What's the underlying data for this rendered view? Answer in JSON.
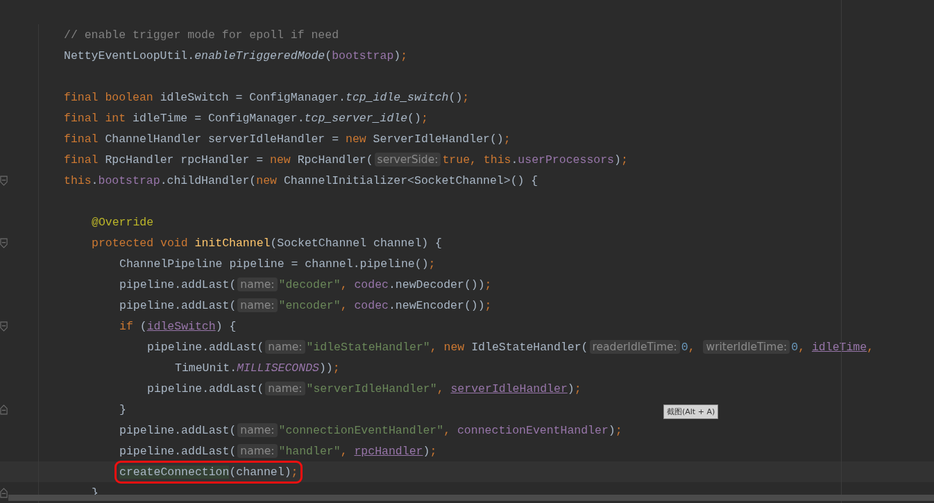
{
  "editor": {
    "lines": [
      {
        "kind": "code",
        "tokens": [
          {
            "kind": "comment",
            "text": "// enable trigger mode for epoll if need"
          }
        ]
      },
      {
        "kind": "code",
        "tokens": [
          {
            "kind": "plain",
            "text": "NettyEventLoopUtil."
          },
          {
            "kind": "static",
            "text": "enableTriggeredMode"
          },
          {
            "kind": "plain",
            "text": "("
          },
          {
            "kind": "field",
            "text": "bootstrap"
          },
          {
            "kind": "plain",
            "text": ")"
          },
          {
            "kind": "punct",
            "text": ";"
          }
        ]
      },
      {
        "kind": "blank"
      },
      {
        "kind": "code",
        "tokens": [
          {
            "kind": "keyword",
            "text": "final boolean"
          },
          {
            "kind": "plain",
            "text": " idleSwitch = ConfigManager."
          },
          {
            "kind": "static",
            "text": "tcp_idle_switch"
          },
          {
            "kind": "plain",
            "text": "()"
          },
          {
            "kind": "punct",
            "text": ";"
          }
        ]
      },
      {
        "kind": "code",
        "tokens": [
          {
            "kind": "keyword",
            "text": "final int"
          },
          {
            "kind": "plain",
            "text": " idleTime = ConfigManager."
          },
          {
            "kind": "static",
            "text": "tcp_server_idle"
          },
          {
            "kind": "plain",
            "text": "()"
          },
          {
            "kind": "punct",
            "text": ";"
          }
        ]
      },
      {
        "kind": "code",
        "tokens": [
          {
            "kind": "keyword",
            "text": "final"
          },
          {
            "kind": "plain",
            "text": " ChannelHandler serverIdleHandler = "
          },
          {
            "kind": "keyword",
            "text": "new"
          },
          {
            "kind": "plain",
            "text": " ServerIdleHandler()"
          },
          {
            "kind": "punct",
            "text": ";"
          }
        ]
      },
      {
        "kind": "code",
        "tokens": [
          {
            "kind": "keyword",
            "text": "final"
          },
          {
            "kind": "plain",
            "text": " RpcHandler rpcHandler = "
          },
          {
            "kind": "keyword",
            "text": "new"
          },
          {
            "kind": "plain",
            "text": " RpcHandler("
          },
          {
            "kind": "hint",
            "text": "serverSide:"
          },
          {
            "kind": "keyword",
            "text": "true"
          },
          {
            "kind": "punct",
            "text": ", "
          },
          {
            "kind": "keyword",
            "text": "this"
          },
          {
            "kind": "plain",
            "text": "."
          },
          {
            "kind": "field",
            "text": "userProcessors"
          },
          {
            "kind": "plain",
            "text": ")"
          },
          {
            "kind": "punct",
            "text": ";"
          }
        ]
      },
      {
        "kind": "code",
        "fold_start": true,
        "tokens": [
          {
            "kind": "keyword",
            "text": "this"
          },
          {
            "kind": "plain",
            "text": "."
          },
          {
            "kind": "field",
            "text": "bootstrap"
          },
          {
            "kind": "plain",
            "text": ".childHandler("
          },
          {
            "kind": "keyword",
            "text": "new"
          },
          {
            "kind": "plain",
            "text": " ChannelInitializer<SocketChannel>() {"
          }
        ],
        "children": [
          {
            "kind": "blank"
          },
          {
            "kind": "code",
            "tokens": [
              {
                "kind": "annotation",
                "text": "@Override"
              }
            ]
          },
          {
            "kind": "code",
            "fold_start": true,
            "tokens": [
              {
                "kind": "keyword",
                "text": "protected void "
              },
              {
                "kind": "method",
                "text": "initChannel"
              },
              {
                "kind": "plain",
                "text": "(SocketChannel channel) {"
              }
            ],
            "children": [
              {
                "kind": "code",
                "tokens": [
                  {
                    "kind": "plain",
                    "text": "ChannelPipeline pipeline = channel.pipeline()"
                  },
                  {
                    "kind": "punct",
                    "text": ";"
                  }
                ]
              },
              {
                "kind": "code",
                "tokens": [
                  {
                    "kind": "plain",
                    "text": "pipeline.addLast("
                  },
                  {
                    "kind": "hint",
                    "text": "name:"
                  },
                  {
                    "kind": "string",
                    "text": "\"decoder\""
                  },
                  {
                    "kind": "punct",
                    "text": ", "
                  },
                  {
                    "kind": "field",
                    "text": "codec"
                  },
                  {
                    "kind": "plain",
                    "text": ".newDecoder())"
                  },
                  {
                    "kind": "punct",
                    "text": ";"
                  }
                ]
              },
              {
                "kind": "code",
                "tokens": [
                  {
                    "kind": "plain",
                    "text": "pipeline.addLast("
                  },
                  {
                    "kind": "hint",
                    "text": "name:"
                  },
                  {
                    "kind": "string",
                    "text": "\"encoder\""
                  },
                  {
                    "kind": "punct",
                    "text": ", "
                  },
                  {
                    "kind": "field",
                    "text": "codec"
                  },
                  {
                    "kind": "plain",
                    "text": ".newEncoder())"
                  },
                  {
                    "kind": "punct",
                    "text": ";"
                  }
                ]
              },
              {
                "kind": "code",
                "fold_start": true,
                "tokens": [
                  {
                    "kind": "keyword",
                    "text": "if"
                  },
                  {
                    "kind": "plain",
                    "text": " ("
                  },
                  {
                    "kind": "link",
                    "text": "idleSwitch"
                  },
                  {
                    "kind": "plain",
                    "text": ") {"
                  }
                ],
                "children": [
                  {
                    "kind": "code",
                    "tokens": [
                      {
                        "kind": "plain",
                        "text": "pipeline.addLast("
                      },
                      {
                        "kind": "hint",
                        "text": "name:"
                      },
                      {
                        "kind": "string",
                        "text": "\"idleStateHandler\""
                      },
                      {
                        "kind": "punct",
                        "text": ", "
                      },
                      {
                        "kind": "keyword",
                        "text": "new"
                      },
                      {
                        "kind": "plain",
                        "text": " IdleStateHandler("
                      },
                      {
                        "kind": "hint",
                        "text": "readerIdleTime:"
                      },
                      {
                        "kind": "number",
                        "text": "0"
                      },
                      {
                        "kind": "punct",
                        "text": ", "
                      },
                      {
                        "kind": "hint",
                        "text": "writerIdleTime:"
                      },
                      {
                        "kind": "number",
                        "text": "0"
                      },
                      {
                        "kind": "punct",
                        "text": ", "
                      },
                      {
                        "kind": "link",
                        "text": "idleTime"
                      },
                      {
                        "kind": "punct",
                        "text": ","
                      }
                    ],
                    "children": [
                      {
                        "kind": "code",
                        "tokens": [
                          {
                            "kind": "plain",
                            "text": "TimeUnit."
                          },
                          {
                            "kind": "constant",
                            "text": "MILLISECONDS"
                          },
                          {
                            "kind": "plain",
                            "text": "))"
                          },
                          {
                            "kind": "punct",
                            "text": ";"
                          }
                        ]
                      }
                    ]
                  },
                  {
                    "kind": "code",
                    "tokens": [
                      {
                        "kind": "plain",
                        "text": "pipeline.addLast("
                      },
                      {
                        "kind": "hint",
                        "text": "name:"
                      },
                      {
                        "kind": "string",
                        "text": "\"serverIdleHandler\""
                      },
                      {
                        "kind": "punct",
                        "text": ", "
                      },
                      {
                        "kind": "link",
                        "text": "serverIdleHandler"
                      },
                      {
                        "kind": "plain",
                        "text": ")"
                      },
                      {
                        "kind": "punct",
                        "text": ";"
                      }
                    ]
                  }
                ]
              },
              {
                "kind": "code",
                "fold_end": true,
                "tokens": [
                  {
                    "kind": "plain",
                    "text": "}"
                  }
                ]
              },
              {
                "kind": "code",
                "tokens": [
                  {
                    "kind": "plain",
                    "text": "pipeline.addLast("
                  },
                  {
                    "kind": "hint",
                    "text": "name:"
                  },
                  {
                    "kind": "string",
                    "text": "\"connectionEventHandler\""
                  },
                  {
                    "kind": "punct",
                    "text": ", "
                  },
                  {
                    "kind": "field",
                    "text": "connectionEventHandler"
                  },
                  {
                    "kind": "plain",
                    "text": ")"
                  },
                  {
                    "kind": "punct",
                    "text": ";"
                  }
                ]
              },
              {
                "kind": "code",
                "tokens": [
                  {
                    "kind": "plain",
                    "text": "pipeline.addLast("
                  },
                  {
                    "kind": "hint",
                    "text": "name:"
                  },
                  {
                    "kind": "string",
                    "text": "\"handler\""
                  },
                  {
                    "kind": "punct",
                    "text": ", "
                  },
                  {
                    "kind": "link",
                    "text": "rpcHandler"
                  },
                  {
                    "kind": "plain",
                    "text": ")"
                  },
                  {
                    "kind": "punct",
                    "text": ";"
                  }
                ]
              },
              {
                "kind": "code",
                "current": true,
                "boxed": true,
                "tokens": [
                  {
                    "kind": "match",
                    "text": "createConnection"
                  },
                  {
                    "kind": "plain",
                    "text": "(channel)"
                  },
                  {
                    "kind": "punct",
                    "text": ";"
                  }
                ]
              }
            ]
          },
          {
            "kind": "code",
            "fold_end": true,
            "tokens": [
              {
                "kind": "plain",
                "text": "}"
              }
            ]
          }
        ]
      }
    ]
  },
  "tooltip": {
    "text": "截图(Alt + A)"
  }
}
